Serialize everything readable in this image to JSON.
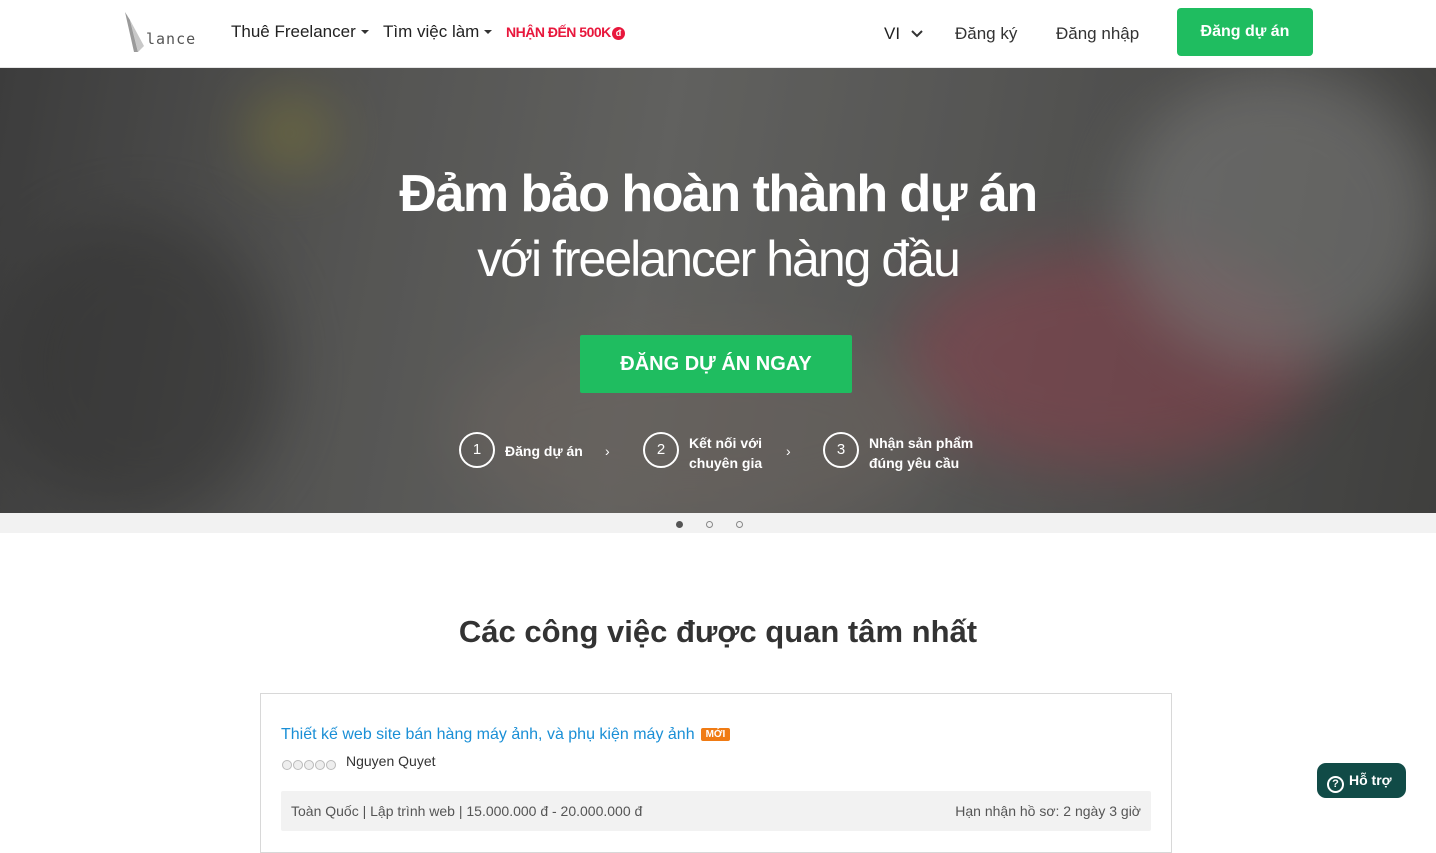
{
  "header": {
    "logo_text": "lance",
    "nav": [
      {
        "label": "Thuê Freelancer"
      },
      {
        "label": "Tìm việc làm"
      }
    ],
    "promo": "NHẬN ĐẾN 500K",
    "promo_coin": "đ",
    "lang": "VI",
    "register": "Đăng ký",
    "login": "Đăng nhập",
    "post_project": "Đăng dự án",
    "accent_color": "#1fbd60",
    "promo_color": "#e8173c"
  },
  "hero": {
    "title": "Đảm bảo hoàn thành dự án",
    "subtitle": "với freelancer hàng đầu",
    "cta": "ĐĂNG DỰ ÁN NGAY",
    "steps": [
      {
        "num": "1",
        "line1": "Đăng dự án",
        "line2": ""
      },
      {
        "num": "2",
        "line1": "Kết nối với",
        "line2": "chuyên gia"
      },
      {
        "num": "3",
        "line1": "Nhận sản phẩm",
        "line2": "đúng yêu cầu"
      }
    ],
    "arrow": "›",
    "slide_active": 1,
    "slide_count": 3
  },
  "jobs": {
    "section_title": "Các công việc được quan tâm nhất",
    "items": [
      {
        "title": "Thiết kế web site bán hàng máy ảnh, và phụ kiện máy ảnh",
        "badge": "MỚI",
        "owner": "Nguyen Quyet",
        "rating": 0,
        "meta": "Toàn Quốc | Lập trình web | 15.000.000 đ - 20.000.000 đ",
        "deadline": "Hạn nhận hồ sơ: 2 ngày 3 giờ"
      }
    ]
  },
  "support": {
    "icon": "?",
    "label": "Hỗ trợ"
  }
}
